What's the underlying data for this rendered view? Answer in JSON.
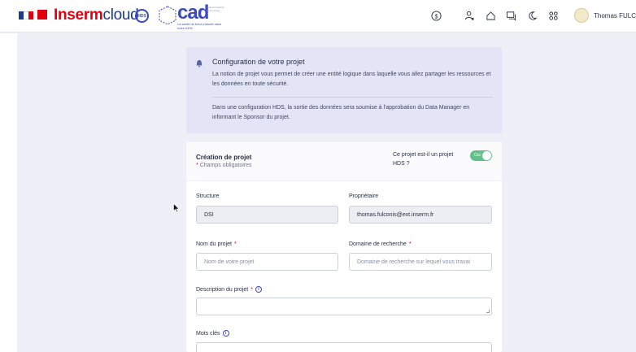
{
  "header": {
    "brand_main": "Inserm",
    "brand_suffix": "cloud",
    "hds_badge": "HDS",
    "cad_logo": "cad",
    "cad_tagline": "La santé du futur s'inscrit dans notre ADN",
    "cad_small": "Collectif Analytic de Données",
    "icons": [
      "dollar-icon",
      "user-key-icon",
      "home-icon",
      "chat-icon",
      "moon-icon",
      "apps-icon"
    ],
    "user_name": "Thomas FULCO"
  },
  "info": {
    "title": "Configuration de votre projet",
    "paragraph1": "La notion de projet vous permet de créer une entité logique dans laquelle vous allez partager les ressources et les données en toute sécurité.",
    "paragraph2": "Dans une configuration HDS, la sortie des données sera soumise à l'approbation du Data Manager en informant le Sponsor du projet."
  },
  "form": {
    "title": "Création de projet",
    "required_star": "*",
    "required_note": "Champs obligatoires",
    "hds_question": "Ce projet est-il un projet HDS ?",
    "hds_toggle_label": "Oui",
    "hds_toggle_on": true,
    "structure_label": "Structure",
    "structure_value": "DSI",
    "owner_label": "Propriétaire",
    "owner_value": "thomas.fulconis@ext.inserm.fr",
    "name_label": "Nom du projet",
    "name_placeholder": "Nom de votre projet",
    "domain_label": "Domaine de recherche",
    "domain_placeholder": "Domaine de recherche sur lequel vous travai",
    "description_label": "Description du projet",
    "keywords_label": "Mots clés",
    "info_glyph": "i"
  },
  "colors": {
    "accent": "#3b4bbd",
    "brand_red": "#e1000f",
    "toggle_on": "#62c08a",
    "background": "#eef0f7",
    "info_bg": "#e3e5f6"
  }
}
